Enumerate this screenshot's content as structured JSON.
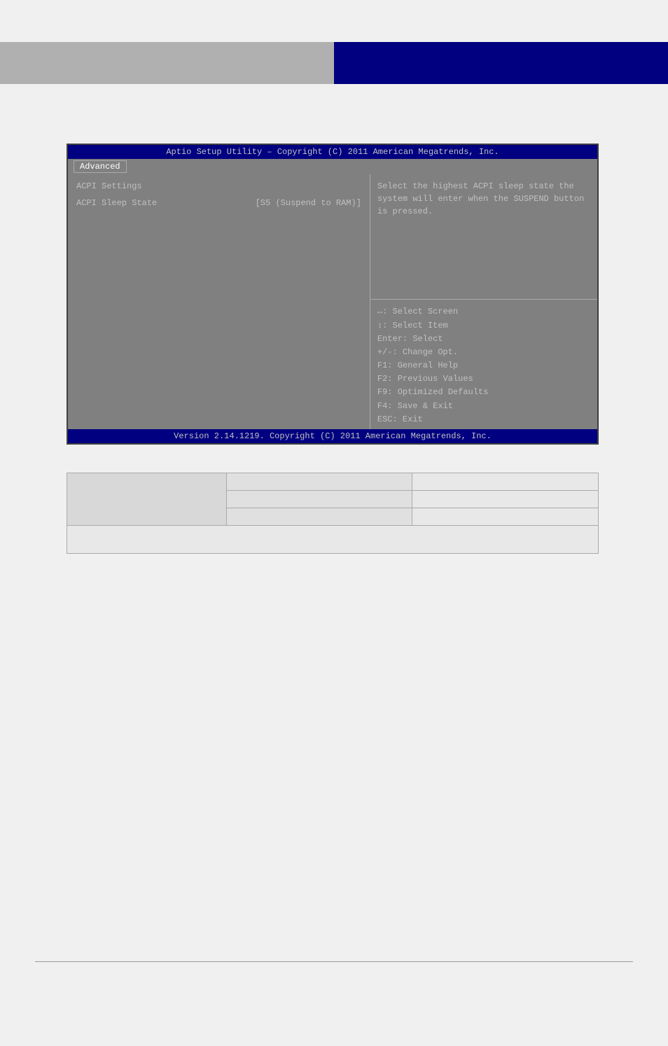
{
  "header": {
    "left_label": "",
    "right_label": ""
  },
  "bios": {
    "title": "Aptio Setup Utility – Copyright (C) 2011 American Megatrends, Inc.",
    "tab": "Advanced",
    "section_title": "ACPI Settings",
    "sleep_state_label": "ACPI Sleep State",
    "sleep_state_value": "[S5 (Suspend to RAM)]",
    "help_text": "Select the highest ACPI sleep state the system will enter when the SUSPEND button is pressed.",
    "keys": {
      "select_screen": "↔: Select Screen",
      "select_item": "↕: Select Item",
      "enter": "Enter: Select",
      "change_opt": "+/-: Change Opt.",
      "general_help": "F1: General Help",
      "previous_values": "F2: Previous Values",
      "optimized_defaults": "F9: Optimized Defaults",
      "save_exit": "F4: Save & Exit",
      "esc_exit": "ESC: Exit"
    },
    "version_bar": "Version 2.14.1219. Copyright (C) 2011 American Megatrends, Inc."
  },
  "table": {
    "rows": [
      [
        "",
        "",
        ""
      ],
      [
        "",
        "",
        ""
      ],
      [
        "",
        "",
        ""
      ]
    ],
    "footer": ""
  }
}
